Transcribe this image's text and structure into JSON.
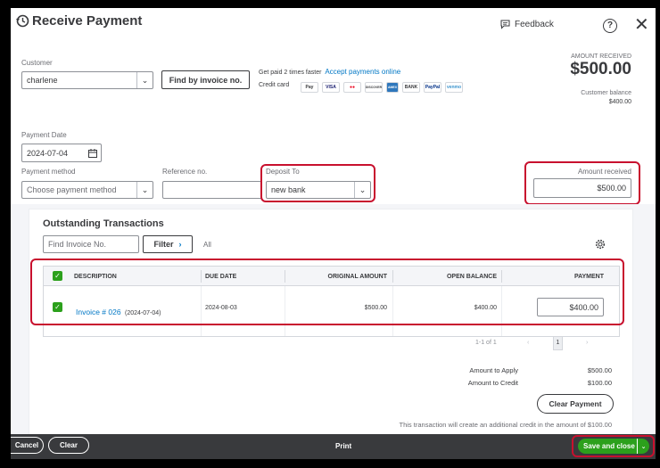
{
  "header": {
    "title": "Receive Payment",
    "feedback_label": "Feedback",
    "help_glyph": "?",
    "close_glyph": "✕"
  },
  "customer": {
    "label": "Customer",
    "value": "charlene",
    "find_button": "Find by invoice no."
  },
  "promo": {
    "text": "Get paid 2 times faster",
    "link": "Accept payments online",
    "credit_card_label": "Credit card",
    "cards": [
      "Pay",
      "VISA",
      "●●",
      "DISCOVER",
      "AMEX",
      "BANK",
      "PayPal",
      "venmo"
    ]
  },
  "amount_summary": {
    "label": "AMOUNT RECEIVED",
    "value": "$500.00",
    "balance_label": "Customer balance",
    "balance_value": "$400.00"
  },
  "payment_date": {
    "label": "Payment Date",
    "value": "2024-07-04"
  },
  "payment_method": {
    "label": "Payment method",
    "placeholder": "Choose payment method"
  },
  "reference": {
    "label": "Reference no.",
    "value": ""
  },
  "deposit_to": {
    "label": "Deposit To",
    "value": "new bank"
  },
  "amount_received": {
    "label": "Amount received",
    "value": "$500.00"
  },
  "outstanding": {
    "title": "Outstanding Transactions",
    "search_placeholder": "Find Invoice No.",
    "filter_label": "Filter",
    "all_label": "All",
    "columns": [
      "DESCRIPTION",
      "DUE DATE",
      "ORIGINAL AMOUNT",
      "OPEN BALANCE",
      "PAYMENT"
    ],
    "rows": [
      {
        "description": "Invoice # 026",
        "date": "(2024-07-04)",
        "due_date": "2024-08-03",
        "original_amount": "$500.00",
        "open_balance": "$400.00",
        "payment": "$400.00"
      }
    ],
    "pagination": {
      "range": "1-1 of 1",
      "page": "1"
    }
  },
  "totals": {
    "apply_label": "Amount to Apply",
    "apply_value": "$500.00",
    "credit_label": "Amount to Credit",
    "credit_value": "$100.00",
    "clear_button": "Clear Payment",
    "note": "This transaction will create an additional credit in the amount of $100.00"
  },
  "footer": {
    "cancel": "Cancel",
    "clear": "Clear",
    "print": "Print",
    "save": "Save and close"
  },
  "colors": {
    "accent_green": "#2ca01c",
    "link_blue": "#0077c5",
    "highlight_red": "#c8102e",
    "footer_bg": "#393a3d"
  }
}
